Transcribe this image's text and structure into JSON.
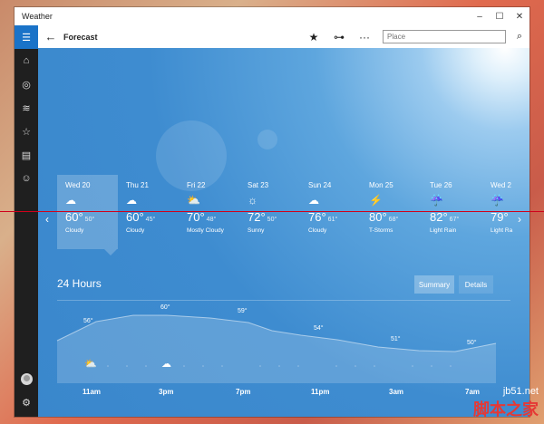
{
  "window": {
    "title": "Weather",
    "controls": [
      "–",
      "☐",
      "✕"
    ]
  },
  "header": {
    "back": "←",
    "title": "Forecast",
    "favorite": "★",
    "pin": "⊶",
    "more": "···",
    "search_placeholder": "Place",
    "search_icon": "⌕"
  },
  "sidebar": {
    "items": [
      {
        "name": "hamburger-icon",
        "glyph": "☰"
      },
      {
        "name": "home-icon",
        "glyph": "⌂"
      },
      {
        "name": "maps-icon",
        "glyph": "◎"
      },
      {
        "name": "historical-icon",
        "glyph": "≋"
      },
      {
        "name": "favorites-icon",
        "glyph": "☆"
      },
      {
        "name": "news-icon",
        "glyph": "▤"
      },
      {
        "name": "feedback-icon",
        "glyph": "☺"
      }
    ],
    "settings": "⚙"
  },
  "days": [
    {
      "name": "Wed 20",
      "high": "60°",
      "low": "50°",
      "cond": "Cloudy",
      "icon": "☁",
      "selected": true
    },
    {
      "name": "Thu 21",
      "high": "60°",
      "low": "45°",
      "cond": "Cloudy",
      "icon": "☁"
    },
    {
      "name": "Fri 22",
      "high": "70°",
      "low": "48°",
      "cond": "Mostly Cloudy",
      "icon": "⛅"
    },
    {
      "name": "Sat 23",
      "high": "72°",
      "low": "50°",
      "cond": "Sunny",
      "icon": "☼"
    },
    {
      "name": "Sun 24",
      "high": "76°",
      "low": "61°",
      "cond": "Cloudy",
      "icon": "☁"
    },
    {
      "name": "Mon 25",
      "high": "80°",
      "low": "68°",
      "cond": "T-Storms",
      "icon": "⚡"
    },
    {
      "name": "Tue 26",
      "high": "82°",
      "low": "67°",
      "cond": "Light Rain",
      "icon": "☔"
    },
    {
      "name": "Wed 2",
      "high": "79°",
      "low": "",
      "cond": "Light Ra",
      "icon": "☔"
    }
  ],
  "hours": {
    "title": "24 Hours",
    "tab_summary": "Summary",
    "tab_details": "Details",
    "temps": [
      "56°",
      "60°",
      "59°",
      "54°",
      "51°",
      "50°"
    ],
    "times": [
      "11am",
      "3pm",
      "7pm",
      "11pm",
      "3am",
      "7am"
    ]
  },
  "watermark": {
    "line1": "jb51.net",
    "line2": "脚本之家"
  }
}
